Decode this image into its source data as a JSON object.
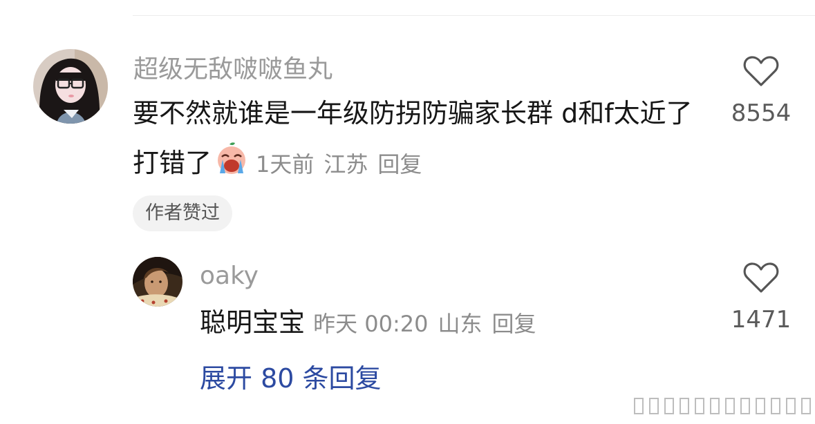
{
  "comment": {
    "username": "超级无敌啵啵鱼丸",
    "text": "要不然就谁是一年级防拐防骗家长群 d和f太近了打错了",
    "emoji": "crying-face-emoji",
    "time": "1天前",
    "location": "江苏",
    "reply_label": "回复",
    "like_count": "8554",
    "badge": "作者赞过"
  },
  "reply": {
    "username": "oaky",
    "text": "聪明宝宝",
    "time": "昨天 00:20",
    "location": "山东",
    "reply_label": "回复",
    "like_count": "1471"
  },
  "expand_label": "展开 80 条回复",
  "colors": {
    "link": "#2c4aa1",
    "username": "#9a9a9a",
    "meta": "#8c8c8c",
    "badge_bg": "#f2f2f2"
  },
  "icons": {
    "like": "heart-outline-icon"
  }
}
